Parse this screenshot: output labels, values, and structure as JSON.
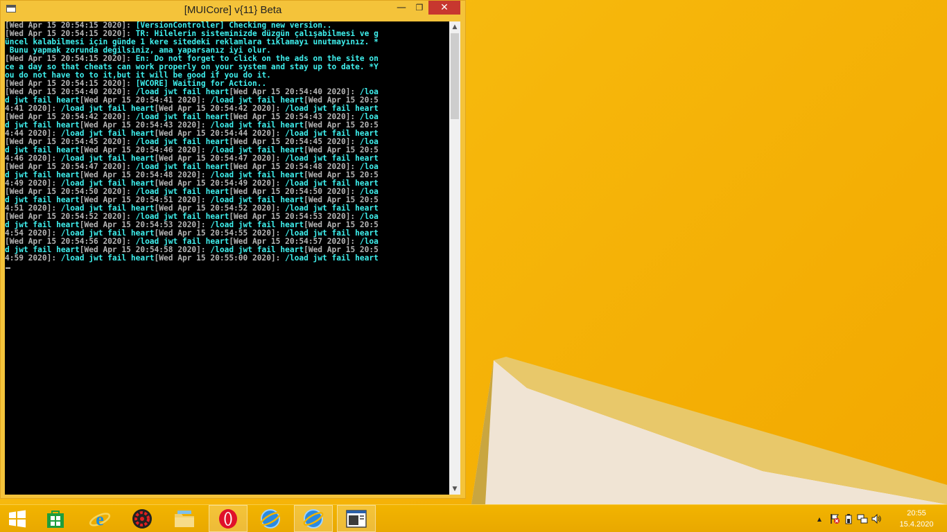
{
  "window": {
    "title": "[MUICore] v{11} Beta",
    "minimize_glyph": "—",
    "maximize_glyph": "❐",
    "close_glyph": "✕"
  },
  "console": {
    "colors": {
      "timestamp": "#b5b5b5",
      "message": "#3ff0ee",
      "background": "#000000"
    },
    "lines": [
      [
        [
          "g",
          "[Wed Apr 15 20:54:15 2020]: "
        ],
        [
          "c",
          "[VersionController] Checking new version.."
        ]
      ],
      [
        [
          "g",
          "[Wed Apr 15 20:54:15 2020]: "
        ],
        [
          "c",
          "TR: Hilelerin sisteminizde düzgün çalışabilmesi ve g"
        ]
      ],
      [
        [
          "c",
          "üncel kalabilmesi için günde 1 kere sitedeki reklamlara tıklamayı unutmayınız. *"
        ]
      ],
      [
        [
          "c",
          " Bunu yapmak zorunda değilsiniz, ama yaparsanız iyi olur."
        ]
      ],
      [
        [
          "g",
          "[Wed Apr 15 20:54:15 2020]: "
        ],
        [
          "c",
          "En: Do not forget to click on the ads on the site on"
        ]
      ],
      [
        [
          "c",
          "ce a day so that cheats can work properly on your system and stay up to date. *Y"
        ]
      ],
      [
        [
          "c",
          "ou do not have to to it,but it will be good if you do it."
        ]
      ],
      [
        [
          "g",
          "[Wed Apr 15 20:54:15 2020]: "
        ],
        [
          "c",
          "[WCORE] Waiting for Action.."
        ]
      ],
      [
        [
          "g",
          "[Wed Apr 15 20:54:40 2020]: "
        ],
        [
          "c",
          "/load jwt fail heart"
        ],
        [
          "g",
          "[Wed Apr 15 20:54:40 2020]: "
        ],
        [
          "c",
          "/loa"
        ]
      ],
      [
        [
          "c",
          "d jwt fail heart"
        ],
        [
          "g",
          "[Wed Apr 15 20:54:41 2020]: "
        ],
        [
          "c",
          "/load jwt fail heart"
        ],
        [
          "g",
          "[Wed Apr 15 20:5"
        ]
      ],
      [
        [
          "g",
          "4:41 2020]: "
        ],
        [
          "c",
          "/load jwt fail heart"
        ],
        [
          "g",
          "[Wed Apr 15 20:54:42 2020]: "
        ],
        [
          "c",
          "/load jwt fail heart"
        ]
      ],
      [
        [
          "g",
          "[Wed Apr 15 20:54:42 2020]: "
        ],
        [
          "c",
          "/load jwt fail heart"
        ],
        [
          "g",
          "[Wed Apr 15 20:54:43 2020]: "
        ],
        [
          "c",
          "/loa"
        ]
      ],
      [
        [
          "c",
          "d jwt fail heart"
        ],
        [
          "g",
          "[Wed Apr 15 20:54:43 2020]: "
        ],
        [
          "c",
          "/load jwt fail heart"
        ],
        [
          "g",
          "[Wed Apr 15 20:5"
        ]
      ],
      [
        [
          "g",
          "4:44 2020]: "
        ],
        [
          "c",
          "/load jwt fail heart"
        ],
        [
          "g",
          "[Wed Apr 15 20:54:44 2020]: "
        ],
        [
          "c",
          "/load jwt fail heart"
        ]
      ],
      [
        [
          "g",
          "[Wed Apr 15 20:54:45 2020]: "
        ],
        [
          "c",
          "/load jwt fail heart"
        ],
        [
          "g",
          "[Wed Apr 15 20:54:45 2020]: "
        ],
        [
          "c",
          "/loa"
        ]
      ],
      [
        [
          "c",
          "d jwt fail heart"
        ],
        [
          "g",
          "[Wed Apr 15 20:54:46 2020]: "
        ],
        [
          "c",
          "/load jwt fail heart"
        ],
        [
          "g",
          "[Wed Apr 15 20:5"
        ]
      ],
      [
        [
          "g",
          "4:46 2020]: "
        ],
        [
          "c",
          "/load jwt fail heart"
        ],
        [
          "g",
          "[Wed Apr 15 20:54:47 2020]: "
        ],
        [
          "c",
          "/load jwt fail heart"
        ]
      ],
      [
        [
          "g",
          "[Wed Apr 15 20:54:47 2020]: "
        ],
        [
          "c",
          "/load jwt fail heart"
        ],
        [
          "g",
          "[Wed Apr 15 20:54:48 2020]: "
        ],
        [
          "c",
          "/loa"
        ]
      ],
      [
        [
          "c",
          "d jwt fail heart"
        ],
        [
          "g",
          "[Wed Apr 15 20:54:48 2020]: "
        ],
        [
          "c",
          "/load jwt fail heart"
        ],
        [
          "g",
          "[Wed Apr 15 20:5"
        ]
      ],
      [
        [
          "g",
          "4:49 2020]: "
        ],
        [
          "c",
          "/load jwt fail heart"
        ],
        [
          "g",
          "[Wed Apr 15 20:54:49 2020]: "
        ],
        [
          "c",
          "/load jwt fail heart"
        ]
      ],
      [
        [
          "g",
          "[Wed Apr 15 20:54:50 2020]: "
        ],
        [
          "c",
          "/load jwt fail heart"
        ],
        [
          "g",
          "[Wed Apr 15 20:54:50 2020]: "
        ],
        [
          "c",
          "/loa"
        ]
      ],
      [
        [
          "c",
          "d jwt fail heart"
        ],
        [
          "g",
          "[Wed Apr 15 20:54:51 2020]: "
        ],
        [
          "c",
          "/load jwt fail heart"
        ],
        [
          "g",
          "[Wed Apr 15 20:5"
        ]
      ],
      [
        [
          "g",
          "4:51 2020]: "
        ],
        [
          "c",
          "/load jwt fail heart"
        ],
        [
          "g",
          "[Wed Apr 15 20:54:52 2020]: "
        ],
        [
          "c",
          "/load jwt fail heart"
        ]
      ],
      [
        [
          "g",
          "[Wed Apr 15 20:54:52 2020]: "
        ],
        [
          "c",
          "/load jwt fail heart"
        ],
        [
          "g",
          "[Wed Apr 15 20:54:53 2020]: "
        ],
        [
          "c",
          "/loa"
        ]
      ],
      [
        [
          "c",
          "d jwt fail heart"
        ],
        [
          "g",
          "[Wed Apr 15 20:54:53 2020]: "
        ],
        [
          "c",
          "/load jwt fail heart"
        ],
        [
          "g",
          "[Wed Apr 15 20:5"
        ]
      ],
      [
        [
          "g",
          "4:54 2020]: "
        ],
        [
          "c",
          "/load jwt fail heart"
        ],
        [
          "g",
          "[Wed Apr 15 20:54:55 2020]: "
        ],
        [
          "c",
          "/load jwt fail heart"
        ]
      ],
      [
        [
          "g",
          "[Wed Apr 15 20:54:56 2020]: "
        ],
        [
          "c",
          "/load jwt fail heart"
        ],
        [
          "g",
          "[Wed Apr 15 20:54:57 2020]: "
        ],
        [
          "c",
          "/loa"
        ]
      ],
      [
        [
          "c",
          "d jwt fail heart"
        ],
        [
          "g",
          "[Wed Apr 15 20:54:58 2020]: "
        ],
        [
          "c",
          "/load jwt fail heart"
        ],
        [
          "g",
          "[Wed Apr 15 20:5"
        ]
      ],
      [
        [
          "g",
          "4:59 2020]: "
        ],
        [
          "c",
          "/load jwt fail heart"
        ],
        [
          "g",
          "[Wed Apr 15 20:55:00 2020]: "
        ],
        [
          "c",
          "/load jwt fail heart"
        ]
      ]
    ]
  },
  "scrollbar": {
    "up_glyph": "▲",
    "down_glyph": "▼"
  },
  "taskbar": {
    "items": [
      {
        "name": "start-button",
        "icon": "windows-logo-icon",
        "active": false
      },
      {
        "name": "taskbar-store",
        "icon": "store-icon",
        "active": false
      },
      {
        "name": "taskbar-internet-explorer",
        "icon": "internet-explorer-icon",
        "active": false
      },
      {
        "name": "taskbar-cheat-engine",
        "icon": "red-gear-app-icon",
        "active": false
      },
      {
        "name": "taskbar-file-explorer",
        "icon": "folder-icon",
        "active": false
      },
      {
        "name": "taskbar-opera",
        "icon": "opera-icon",
        "active": true
      },
      {
        "name": "taskbar-globe-app",
        "icon": "blue-globe-icon",
        "active": false
      },
      {
        "name": "taskbar-globe-app-2",
        "icon": "blue-globe-icon",
        "active": true
      },
      {
        "name": "taskbar-console",
        "icon": "console-window-icon",
        "active": true
      }
    ],
    "tray": {
      "show_hidden_glyph": "▲",
      "icons": [
        "action-center-flag-icon",
        "battery-icon",
        "network-icon",
        "volume-icon"
      ]
    },
    "clock": {
      "time": "20:55",
      "date": "15.4.2020"
    }
  }
}
